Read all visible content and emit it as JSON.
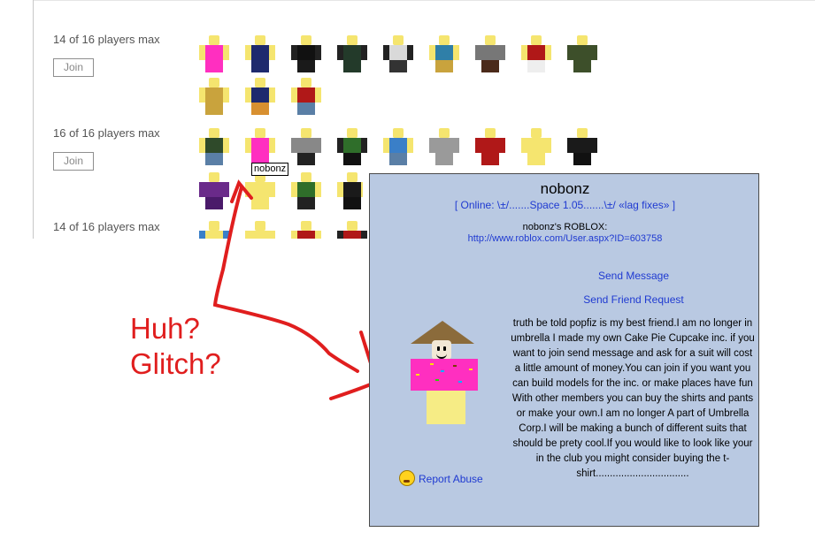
{
  "servers": [
    {
      "count_text": "14 of 16 players max",
      "join_label": "Join"
    },
    {
      "count_text": "16 of 16 players max",
      "join_label": "Join"
    },
    {
      "count_text": "14 of 16 players max"
    }
  ],
  "tooltip": "nobonz",
  "profile": {
    "name": "nobonz",
    "status": "[ Online: \\±/.......Space 1.05.......\\±/ «lag fixes» ]",
    "roblox_label": "nobonz's ROBLOX:",
    "roblox_url": "http://www.roblox.com/User.aspx?ID=603758",
    "send_message": "Send Message",
    "send_friend_request": "Send Friend Request",
    "bio": "truth be told popfiz is my best friend.I am no longer in umbrella I made my own Cake Pie Cupcake inc. if you want to join send message and ask for a suit will cost a little amount of money.You can join if you want you can build models for the inc. or make places have fun With other members you can buy the shirts and pants or make your own.I am no longer A part of Umbrella Corp.I will be making a bunch of different suits that should be prety cool.If you would like to look like your in the club you might consider buying the t-shirt.................................",
    "report_abuse": "Report Abuse"
  },
  "annotation": {
    "line1": "Huh?",
    "line2": "Glitch?"
  },
  "colors": {
    "annotation": "#e01e1e",
    "link": "#1f3ad1",
    "panel_bg": "#b9c9e2"
  }
}
